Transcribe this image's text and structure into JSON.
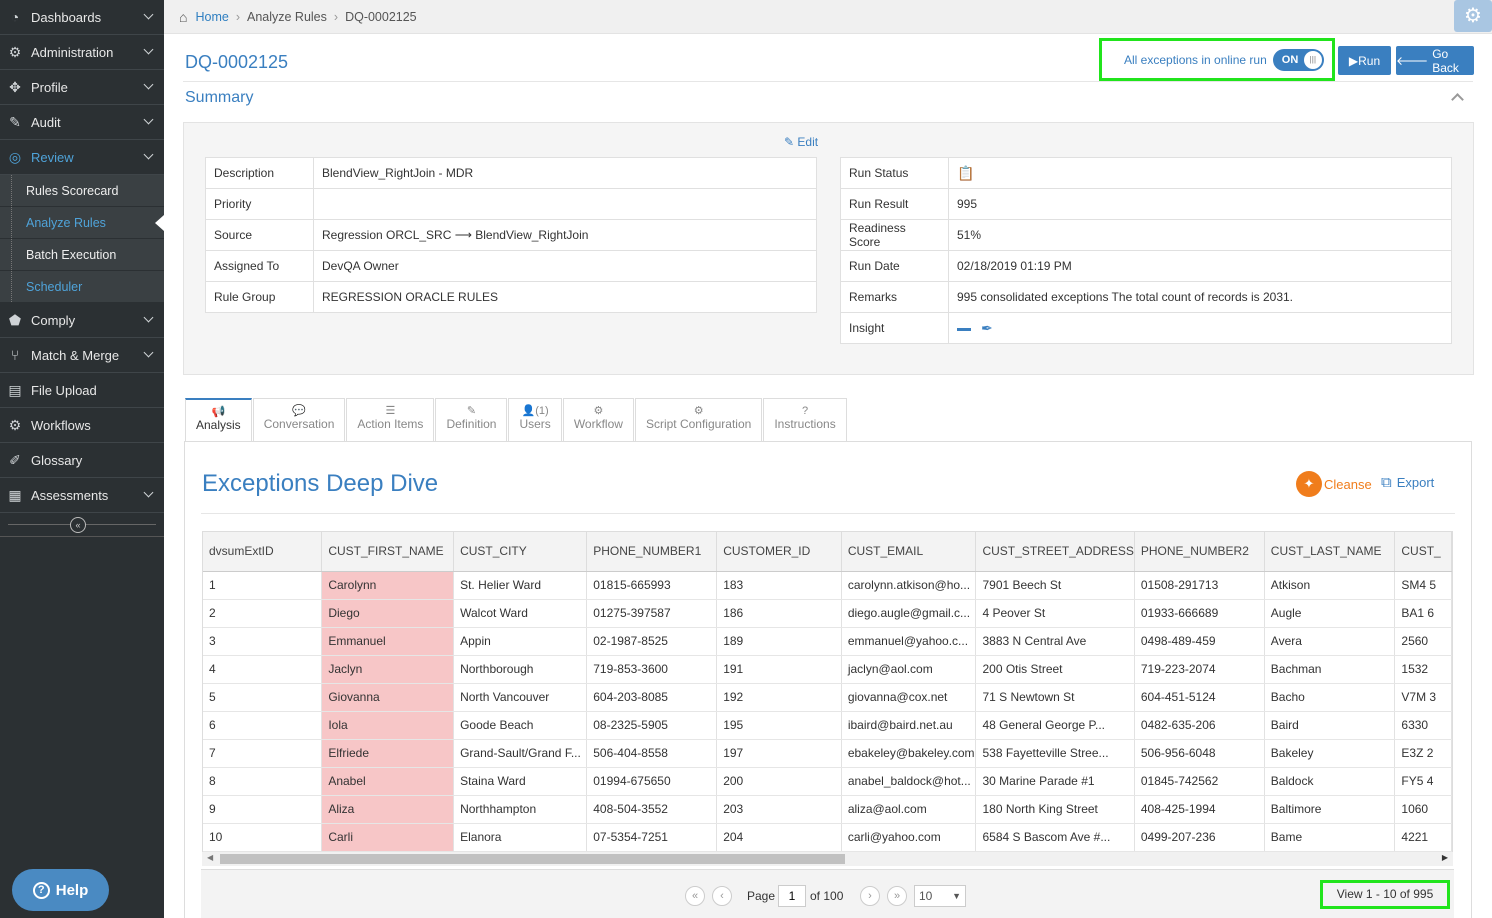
{
  "sidebar": {
    "items": [
      {
        "label": "Dashboards",
        "icon": "dashboard-icon"
      },
      {
        "label": "Administration",
        "icon": "cogs-icon"
      },
      {
        "label": "Profile",
        "icon": "crosshair-icon"
      },
      {
        "label": "Audit",
        "icon": "edit-icon"
      },
      {
        "label": "Review",
        "icon": "target-icon"
      }
    ],
    "review_sub": [
      "Rules Scorecard",
      "Analyze Rules",
      "Batch Execution",
      "Scheduler"
    ],
    "items2": [
      {
        "label": "Comply",
        "icon": "tag-icon"
      },
      {
        "label": "Match & Merge",
        "icon": "merge-icon"
      },
      {
        "label": "File Upload",
        "icon": "file-icon"
      },
      {
        "label": "Workflows",
        "icon": "workflow-icon"
      },
      {
        "label": "Glossary",
        "icon": "book-icon"
      },
      {
        "label": "Assessments",
        "icon": "clipboard-icon"
      }
    ],
    "collapse_glyph": "«",
    "help_label": "Help"
  },
  "breadcrumb": {
    "home": "Home",
    "section": "Analyze Rules",
    "current": "DQ-0002125"
  },
  "header": {
    "title": "DQ-0002125",
    "online_label": "All exceptions in online run",
    "toggle_label": "ON",
    "run_label": "Run",
    "goback_label": "Go Back"
  },
  "summary": {
    "title": "Summary",
    "edit_label": "Edit",
    "left": [
      {
        "k": "Description",
        "v": "BlendView_RightJoin - MDR"
      },
      {
        "k": "Priority",
        "v": ""
      },
      {
        "k": "Source",
        "v": "Regression ORCL_SRC ⟶ BlendView_RightJoin"
      },
      {
        "k": "Assigned To",
        "v": "DevQA Owner"
      },
      {
        "k": "Rule Group",
        "v": "REGRESSION ORACLE RULES"
      }
    ],
    "right": [
      {
        "k": "Run Status",
        "v": ""
      },
      {
        "k": "Run Result",
        "v": "995"
      },
      {
        "k": "Readiness Score",
        "v": "51%"
      },
      {
        "k": "Run Date",
        "v": "02/18/2019 01:19 PM"
      },
      {
        "k": "Remarks",
        "v": "995 consolidated exceptions The total count of records is 2031."
      },
      {
        "k": "Insight",
        "v": ""
      }
    ]
  },
  "tabs": [
    {
      "label": "Analysis",
      "icon": "📢"
    },
    {
      "label": "Conversation",
      "icon": "💬"
    },
    {
      "label": "Action Items",
      "icon": "☰"
    },
    {
      "label": "Definition",
      "icon": "✎"
    },
    {
      "label": "Users",
      "icon": "👤(1)"
    },
    {
      "label": "Workflow",
      "icon": "⚙"
    },
    {
      "label": "Script Configuration",
      "icon": "⚙"
    },
    {
      "label": "Instructions",
      "icon": "?"
    }
  ],
  "exceptions": {
    "title": "Exceptions Deep Dive",
    "cleanse_label": "Cleanse",
    "export_label": "Export"
  },
  "grid": {
    "columns": [
      "dvsumExtID",
      "CUST_FIRST_NAME",
      "CUST_CITY",
      "PHONE_NUMBER1",
      "CUSTOMER_ID",
      "CUST_EMAIL",
      "CUST_STREET_ADDRESS",
      "PHONE_NUMBER2",
      "CUST_LAST_NAME",
      "CUST_"
    ],
    "rows": [
      [
        "1",
        "Carolynn",
        "St. Helier Ward",
        "01815-665993",
        "183",
        "carolynn.atkison@ho...",
        "7901 Beech St",
        "01508-291713",
        "Atkison",
        "SM4 5"
      ],
      [
        "2",
        "Diego",
        "Walcot Ward",
        "01275-397587",
        "186",
        "diego.augle@gmail.c...",
        "4 Peover St",
        "01933-666689",
        "Augle",
        "BA1 6"
      ],
      [
        "3",
        "Emmanuel",
        "Appin",
        "02-1987-8525",
        "189",
        "emmanuel@yahoo.c...",
        "3883 N Central Ave",
        "0498-489-459",
        "Avera",
        "2560"
      ],
      [
        "4",
        "Jaclyn",
        "Northborough",
        "719-853-3600",
        "191",
        "jaclyn@aol.com",
        "200 Otis Street",
        "719-223-2074",
        "Bachman",
        "1532"
      ],
      [
        "5",
        "Giovanna",
        "North Vancouver",
        "604-203-8085",
        "192",
        "giovanna@cox.net",
        "71 S Newtown St",
        "604-451-5124",
        "Bacho",
        "V7M 3"
      ],
      [
        "6",
        "Iola",
        "Goode Beach",
        "08-2325-5905",
        "195",
        "ibaird@baird.net.au",
        "48 General George P...",
        "0482-635-206",
        "Baird",
        "6330"
      ],
      [
        "7",
        "Elfriede",
        "Grand-Sault/Grand F...",
        "506-404-8558",
        "197",
        "ebakeley@bakeley.com",
        "538 Fayetteville Stree...",
        "506-956-6048",
        "Bakeley",
        "E3Z 2"
      ],
      [
        "8",
        "Anabel",
        "Staina Ward",
        "01994-675650",
        "200",
        "anabel_baldock@hot...",
        "30 Marine Parade #1",
        "01845-742562",
        "Baldock",
        "FY5 4"
      ],
      [
        "9",
        "Aliza",
        "Northhampton",
        "408-504-3552",
        "203",
        "aliza@aol.com",
        "180 North King Street",
        "408-425-1994",
        "Baltimore",
        "1060"
      ],
      [
        "10",
        "Carli",
        "Elanora",
        "07-5354-7251",
        "204",
        "carli@yahoo.com",
        "6584 S Bascom Ave #...",
        "0499-207-236",
        "Bame",
        "4221"
      ]
    ]
  },
  "pager": {
    "page_label": "Page",
    "page_value": "1",
    "of_label": "of 100",
    "rows_value": "10",
    "view_info": "View 1 - 10 of 995"
  },
  "colors": {
    "accent": "#3a7fc0",
    "exception_cell": "#f7c6c7",
    "highlight": "#21e41c",
    "cleanse": "#f07d1c"
  }
}
